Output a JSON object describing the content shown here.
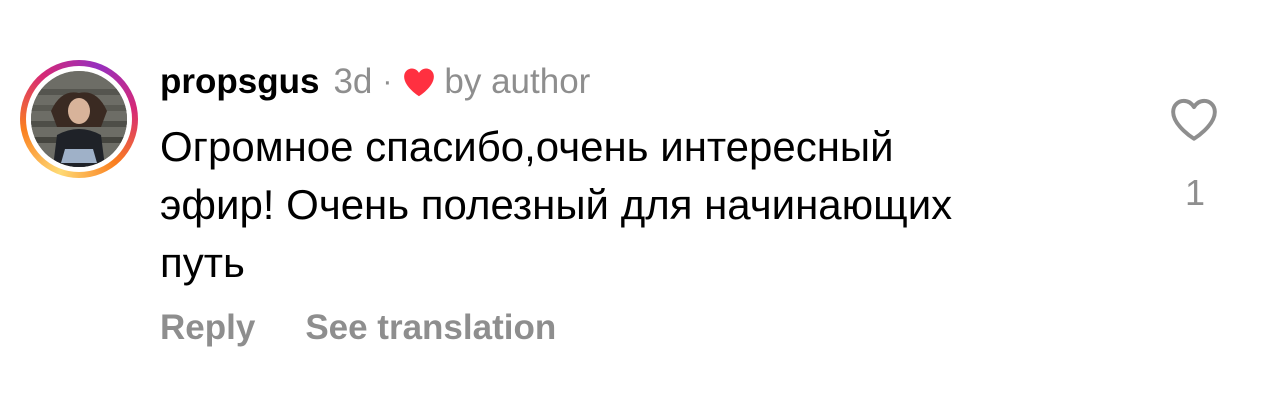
{
  "comment": {
    "username": "propsgus",
    "time": "3d",
    "separator": "·",
    "author_like_label": "by author",
    "text": "Огромное спасибо,очень интересный\nэфир! Очень полезный для начинающих\nпуть",
    "actions": {
      "reply": "Reply",
      "see_translation": "See translation"
    },
    "like_count": "1",
    "icons": {
      "author_heart": "filled-heart-icon",
      "like": "heart-outline-icon"
    },
    "colors": {
      "heart_red": "#ff3040",
      "muted_text": "#8e8e8e"
    }
  }
}
